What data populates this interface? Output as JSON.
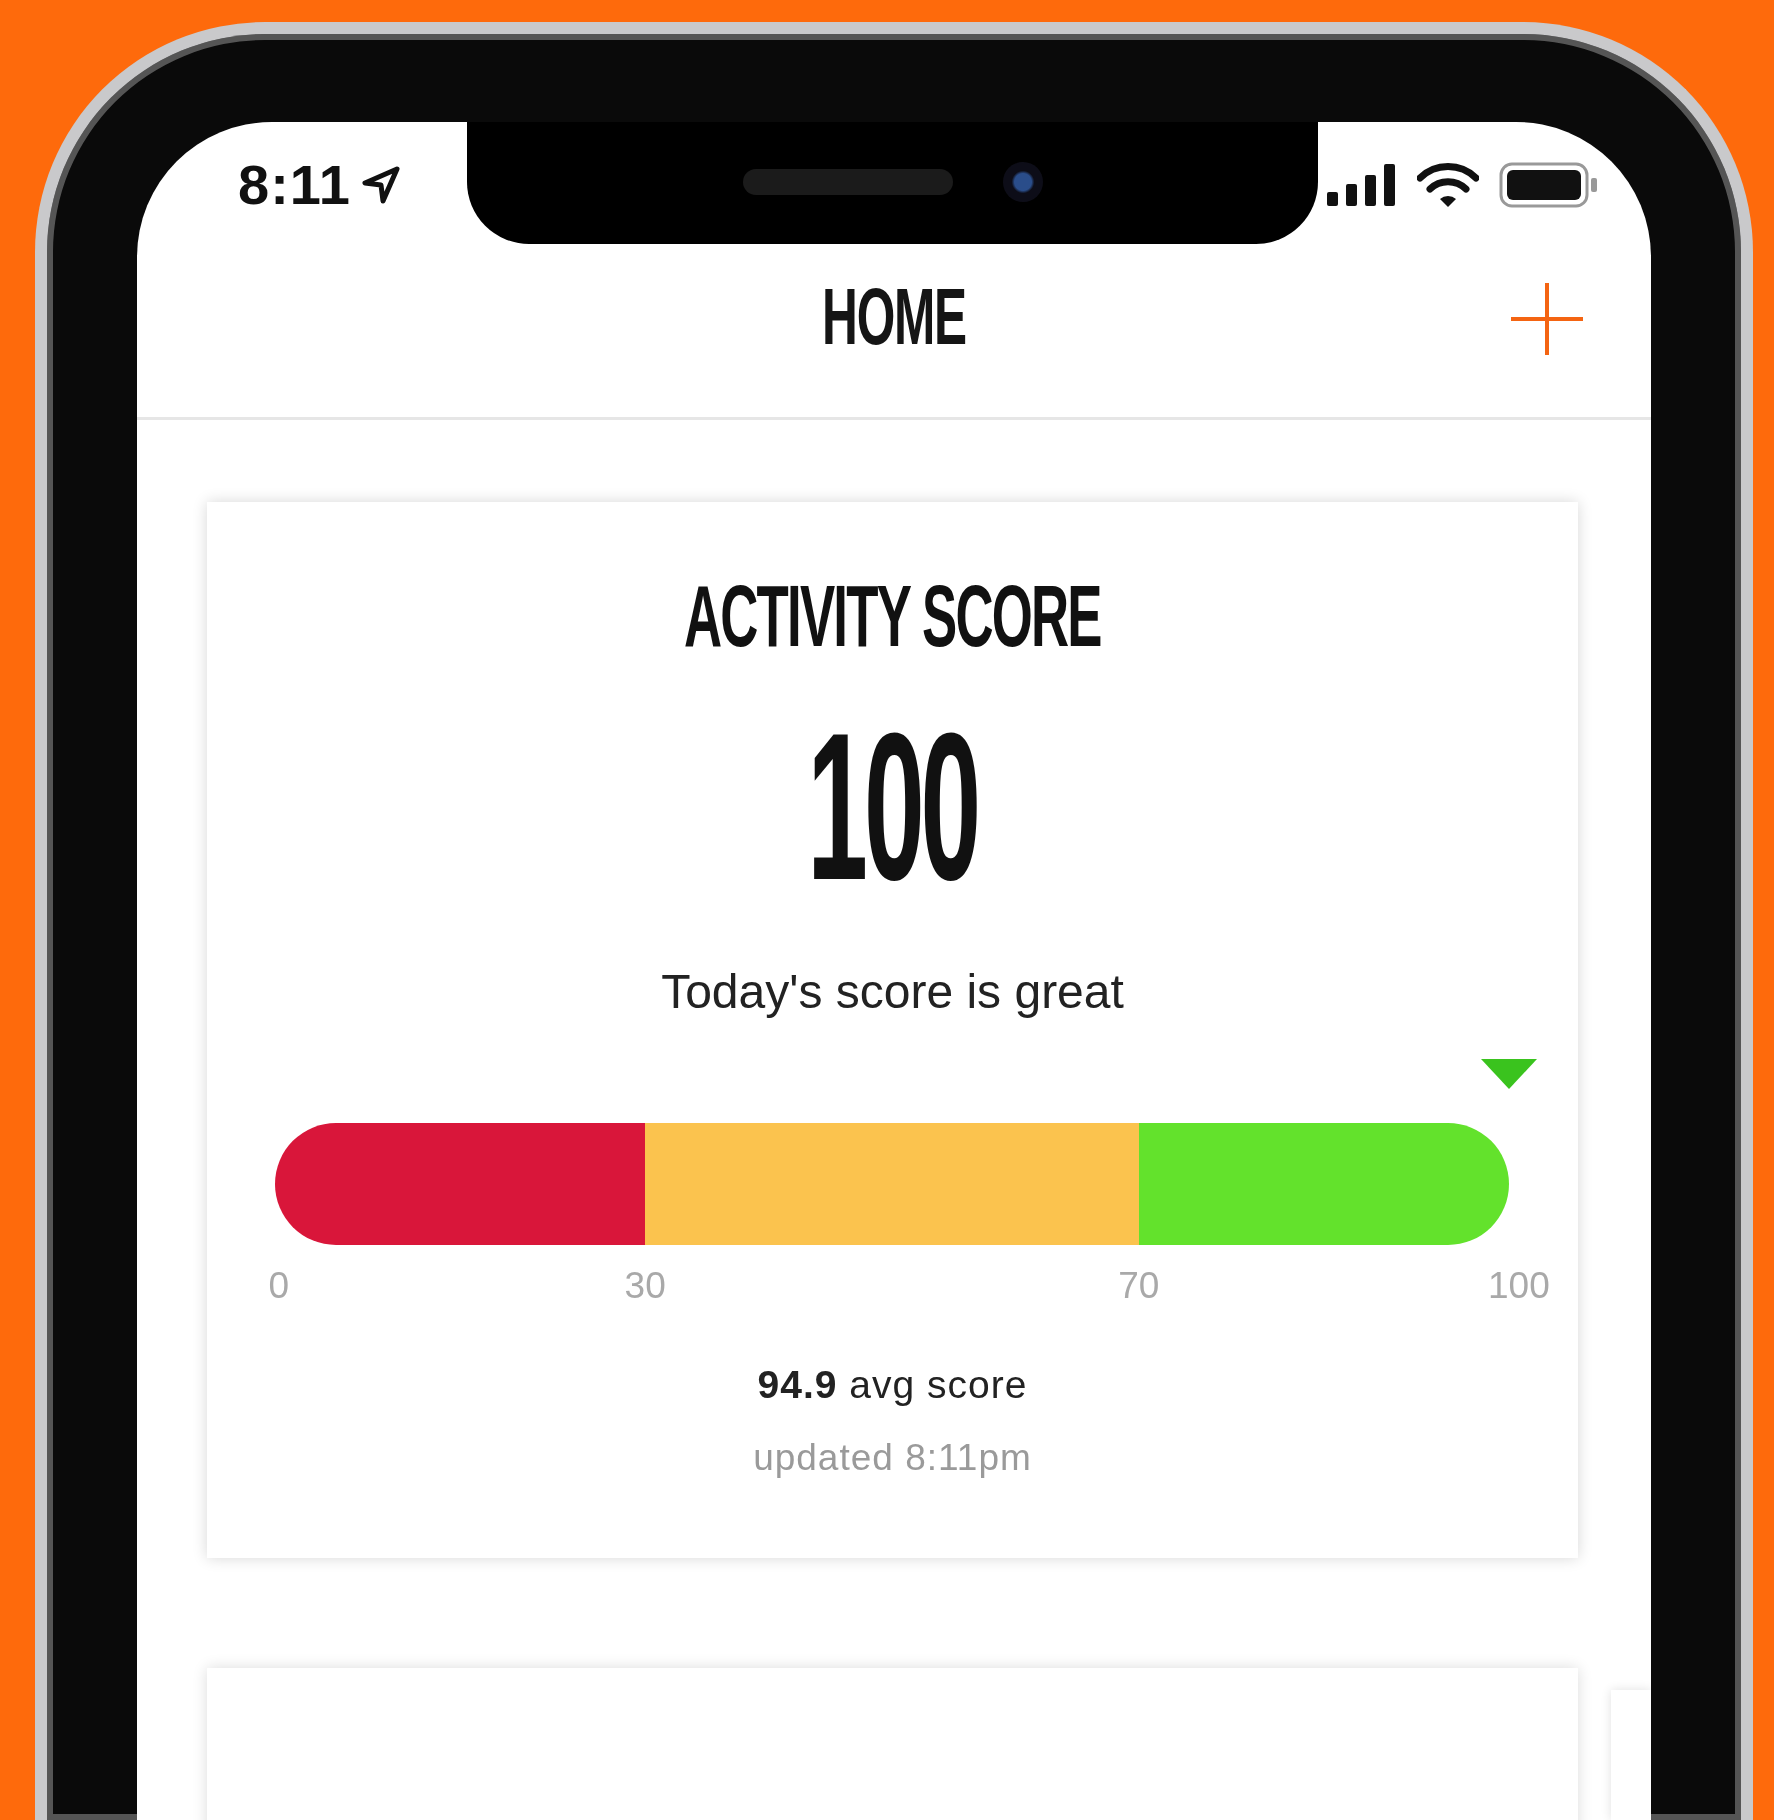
{
  "status_bar": {
    "time": "8:11"
  },
  "header": {
    "title": "HOME"
  },
  "activity_card": {
    "title": "ACTIVITY SCORE",
    "score": "100",
    "message": "Today's score is great",
    "gauge": {
      "level": 1,
      "segments": [
        {
          "color": "#d9163a"
        },
        {
          "color": "#fbc34e"
        },
        {
          "color": "#63e22c"
        }
      ],
      "ticks": [
        "0",
        "30",
        "70",
        "100"
      ]
    },
    "average": "**94.9** avg score",
    "updated": "updated 8:11pm"
  }
}
